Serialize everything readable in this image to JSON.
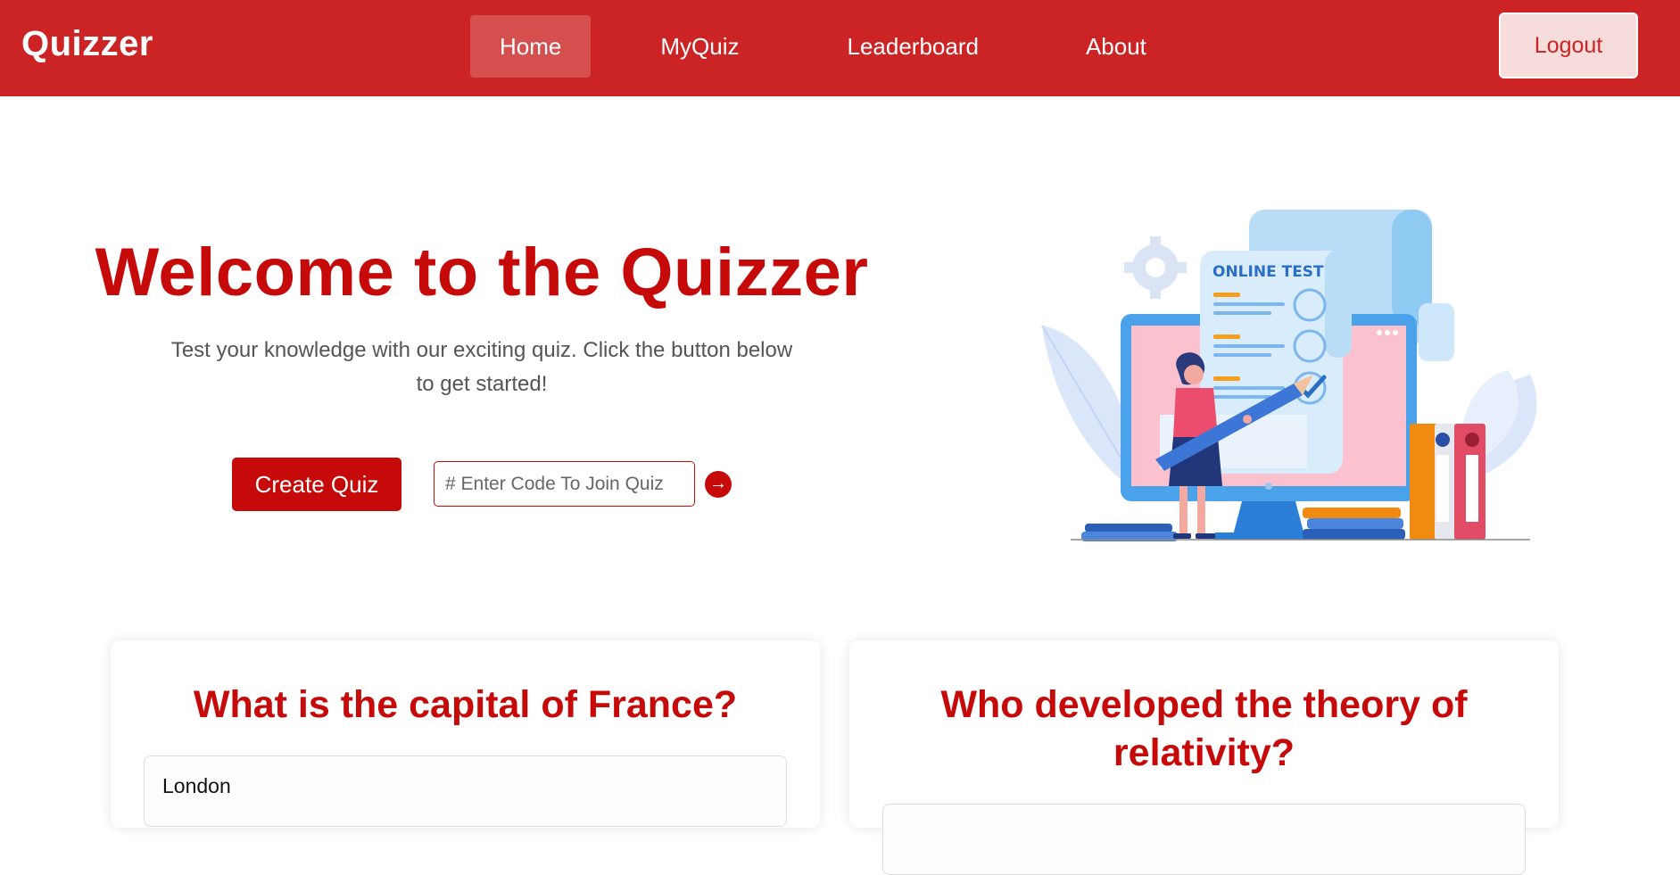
{
  "brand": "Quizzer",
  "nav": {
    "links": [
      "Home",
      "MyQuiz",
      "Leaderboard",
      "About"
    ],
    "active": "Home",
    "logout_label": "Logout"
  },
  "hero": {
    "title": "Welcome to the Quizzer",
    "subtitle": "Test your knowledge with our exciting quiz. Click the button below to get started!",
    "create_label": "Create Quiz",
    "code_placeholder": "# Enter Code To Join Quiz",
    "go_icon": "arrow-right-icon"
  },
  "illustration": {
    "label": "ONLINE TEST"
  },
  "quizzes": [
    {
      "question": "What is the capital of France?",
      "first_option": "London"
    },
    {
      "question": "Who developed the theory of relativity?",
      "first_option": ""
    }
  ],
  "colors": {
    "brand_red": "#cc2424",
    "accent_red": "#c60909",
    "logout_bg": "#f7dcdc"
  }
}
